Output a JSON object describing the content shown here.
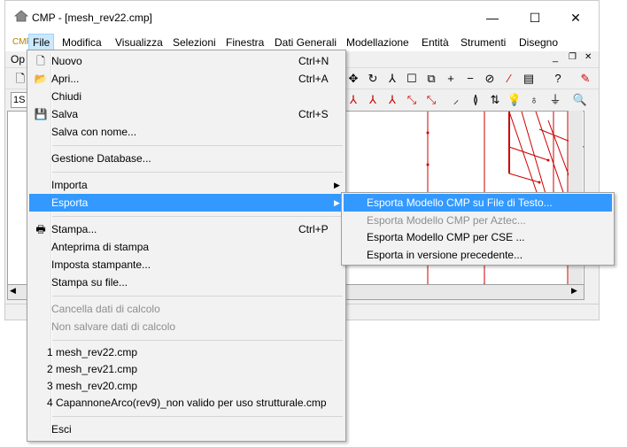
{
  "window": {
    "title": "CMP - [mesh_rev22.cmp]",
    "minimize": "—",
    "maximize": "☐",
    "close": "✕"
  },
  "menubar": [
    "File",
    "Modifica",
    "Visualizza",
    "Selezioni",
    "Finestra",
    "Dati Generali",
    "Modellazione",
    "Entità",
    "Strumenti",
    "Disegno"
  ],
  "menubar_prefix": "CMP",
  "row2": {
    "left_text": "Op",
    "combo_value": "1S"
  },
  "file_menu": {
    "items": [
      {
        "label": "Nuovo",
        "shortcut": "Ctrl+N",
        "icon": "new-file-icon"
      },
      {
        "label": "Apri...",
        "shortcut": "Ctrl+A",
        "icon": "open-folder-icon"
      },
      {
        "label": "Chiudi"
      },
      {
        "label": "Salva",
        "shortcut": "Ctrl+S",
        "icon": "save-icon"
      },
      {
        "label": "Salva con nome..."
      },
      {
        "label": "Gestione Database..."
      },
      {
        "label": "Importa"
      },
      {
        "label": "Esporta"
      },
      {
        "label": "Stampa...",
        "shortcut": "Ctrl+P",
        "icon": "printer-icon"
      },
      {
        "label": "Anteprima di stampa"
      },
      {
        "label": "Imposta stampante..."
      },
      {
        "label": "Stampa su file..."
      },
      {
        "label": "Cancella dati di calcolo"
      },
      {
        "label": "Non salvare dati di calcolo"
      },
      {
        "label": "1 mesh_rev22.cmp"
      },
      {
        "label": "2 mesh_rev21.cmp"
      },
      {
        "label": "3 mesh_rev20.cmp"
      },
      {
        "label": "4 CapannoneArco(rev9)_non valido per uso strutturale.cmp"
      },
      {
        "label": "Esci"
      }
    ]
  },
  "export_submenu": [
    {
      "label": "Esporta Modello CMP su File di Testo..."
    },
    {
      "label": "Esporta Modello CMP per Aztec..."
    },
    {
      "label": "Esporta Modello CMP per CSE ..."
    },
    {
      "label": "Esporta in versione precedente..."
    }
  ],
  "colors": {
    "highlight": "#3399ff",
    "accent_red": "#cc0000",
    "menu_bg": "#f2f2f2"
  }
}
